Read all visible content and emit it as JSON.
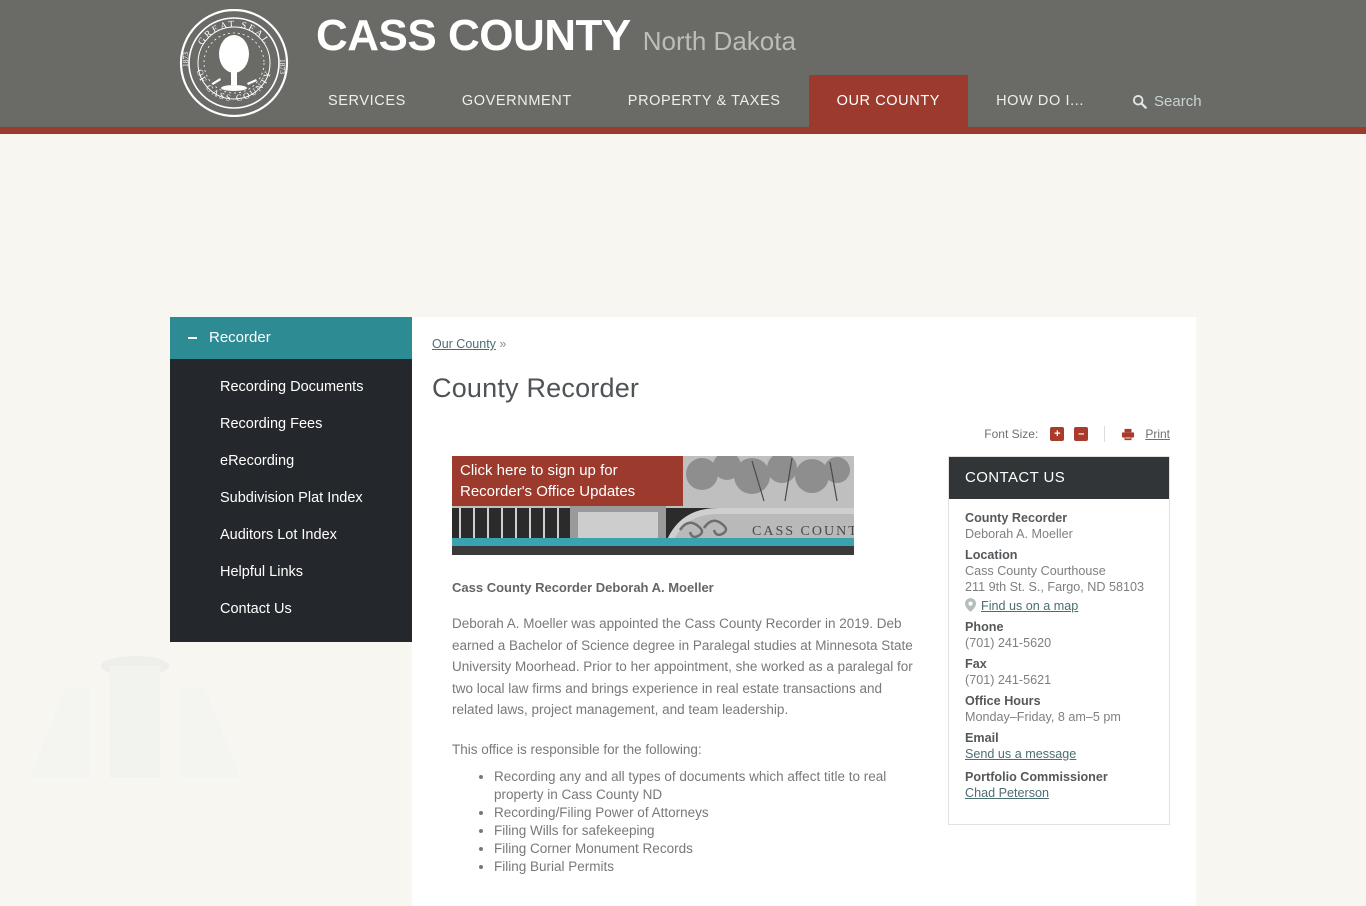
{
  "header": {
    "seal_icon": "county-seal-icon",
    "seal_text_top": "GREAT SEAL",
    "seal_text_bottom": "OF CASS COUNTY",
    "seal_year_left": "1873",
    "seal_year_right": "1873",
    "brand_main": "CASS COUNTY",
    "brand_sub": "North Dakota",
    "accent_color": "#9c3b2d",
    "bar_color": "#6a6a67",
    "nav": [
      {
        "label": "SERVICES",
        "active": false
      },
      {
        "label": "GOVERNMENT",
        "active": false
      },
      {
        "label": "PROPERTY & TAXES",
        "active": false
      },
      {
        "label": "OUR COUNTY",
        "active": true
      },
      {
        "label": "HOW DO I...",
        "active": false
      }
    ],
    "search_label": "Search",
    "search_icon": "search-icon"
  },
  "sidebar": {
    "section_title": "Recorder",
    "collapse_icon": "minus-icon",
    "header_color": "#2d8b93",
    "items": [
      {
        "label": "Recording Documents"
      },
      {
        "label": "Recording Fees"
      },
      {
        "label": "eRecording"
      },
      {
        "label": "Subdivision Plat Index"
      },
      {
        "label": "Auditors Lot Index"
      },
      {
        "label": "Helpful Links"
      },
      {
        "label": "Contact Us"
      }
    ]
  },
  "main": {
    "breadcrumb_link": "Our County",
    "breadcrumb_separator": "»",
    "title": "County Recorder",
    "toolbar": {
      "font_size_label": "Font Size:",
      "increase_label": "+",
      "decrease_label": "–",
      "print_label": "Print",
      "print_icon": "printer-icon"
    },
    "promo": {
      "line1": "Click here to sign up for",
      "line2": "Recorder's Office Updates",
      "image_alt": "Cass County stone sign",
      "sign_text": "CASS COUNTY",
      "overlay_color": "#9c3b2d",
      "strip_color": "#3aa3af"
    },
    "lead": "Cass County Recorder Deborah A. Moeller",
    "paragraphs": [
      "Deborah A. Moeller was appointed the Cass County Recorder in 2019. Deb earned a Bachelor of Science degree in Paralegal studies at Minnesota State University Moorhead. Prior to her appointment, she worked as a paralegal for two local law firms and brings experience in real estate transactions and related laws, project management, and team leadership.",
      "This office is responsible for the following:"
    ],
    "responsibilities": [
      "Recording any and all types of documents which affect title to real property in Cass County ND",
      "Recording/Filing Power of Attorneys",
      "Filing Wills for safekeeping",
      "Filing Corner Monument Records",
      "Filing Burial Permits"
    ]
  },
  "contact": {
    "heading": "CONTACT US",
    "recorder_label": "County Recorder",
    "recorder_name": "Deborah A. Moeller",
    "location_label": "Location",
    "location_line1": "Cass County Courthouse",
    "location_line2": "211 9th St. S., Fargo, ND 58103",
    "map_link": "Find us on a map",
    "map_icon": "map-pin-icon",
    "phone_label": "Phone",
    "phone_value": "(701) 241-5620",
    "fax_label": "Fax",
    "fax_value": "(701) 241-5621",
    "hours_label": "Office Hours",
    "hours_value": "Monday–Friday, 8 am–5 pm",
    "email_label": "Email",
    "email_link": "Send us a message",
    "commissioner_label": "Portfolio Commissioner",
    "commissioner_link": "Chad Peterson"
  }
}
